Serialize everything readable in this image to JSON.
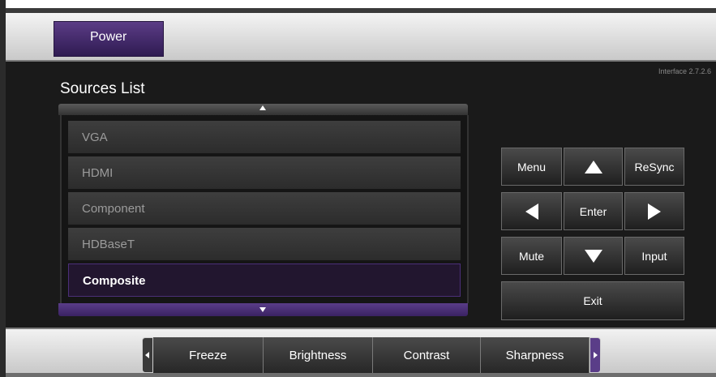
{
  "header": {
    "power_label": "Power"
  },
  "main": {
    "version_text": "Interface 2.7.2.6",
    "sources_title": "Sources List",
    "sources": [
      {
        "label": "VGA",
        "selected": false
      },
      {
        "label": "HDMI",
        "selected": false
      },
      {
        "label": "Component",
        "selected": false
      },
      {
        "label": "HDBaseT",
        "selected": false
      },
      {
        "label": "Composite",
        "selected": true
      }
    ]
  },
  "controls": {
    "menu_label": "Menu",
    "resync_label": "ReSync",
    "enter_label": "Enter",
    "mute_label": "Mute",
    "input_label": "Input",
    "exit_label": "Exit"
  },
  "bottom_tabs": {
    "items": [
      {
        "label": "Freeze"
      },
      {
        "label": "Brightness"
      },
      {
        "label": "Contrast"
      },
      {
        "label": "Sharpness"
      }
    ]
  },
  "colors": {
    "accent_purple": "#5a3d88",
    "selected_item_bg": "#22162f",
    "panel_bg": "#1a1a1a"
  },
  "icons": {
    "list_up": "triangle-up-icon",
    "list_down": "triangle-down-icon",
    "nav_up": "arrow-up-icon",
    "nav_down": "arrow-down-icon",
    "nav_left": "arrow-left-icon",
    "nav_right": "arrow-right-icon"
  }
}
